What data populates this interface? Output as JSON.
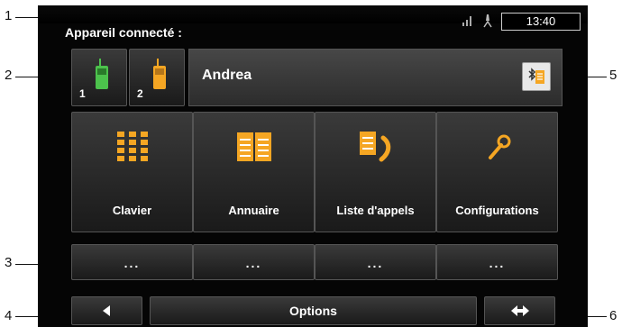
{
  "callouts": [
    "1",
    "2",
    "3",
    "4",
    "5",
    "6"
  ],
  "header": {
    "title": "Appareil connecté :",
    "clock": "13:40"
  },
  "devices": [
    {
      "number": "1",
      "color": "#4cc24c"
    },
    {
      "number": "2",
      "color": "#f5a623"
    }
  ],
  "connected": {
    "name": "Andrea"
  },
  "menu": [
    {
      "label": "Clavier",
      "icon": "keypad-icon"
    },
    {
      "label": "Annuaire",
      "icon": "phonebook-icon"
    },
    {
      "label": "Liste d'appels",
      "icon": "call-list-icon"
    },
    {
      "label": "Configurations",
      "icon": "wrench-icon"
    }
  ],
  "quick_dials": [
    {
      "label": "..."
    },
    {
      "label": "..."
    },
    {
      "label": "..."
    },
    {
      "label": "..."
    }
  ],
  "bottom": {
    "options": "Options"
  },
  "colors": {
    "accent": "#f5a623",
    "active_phone": "#4cc24c"
  }
}
